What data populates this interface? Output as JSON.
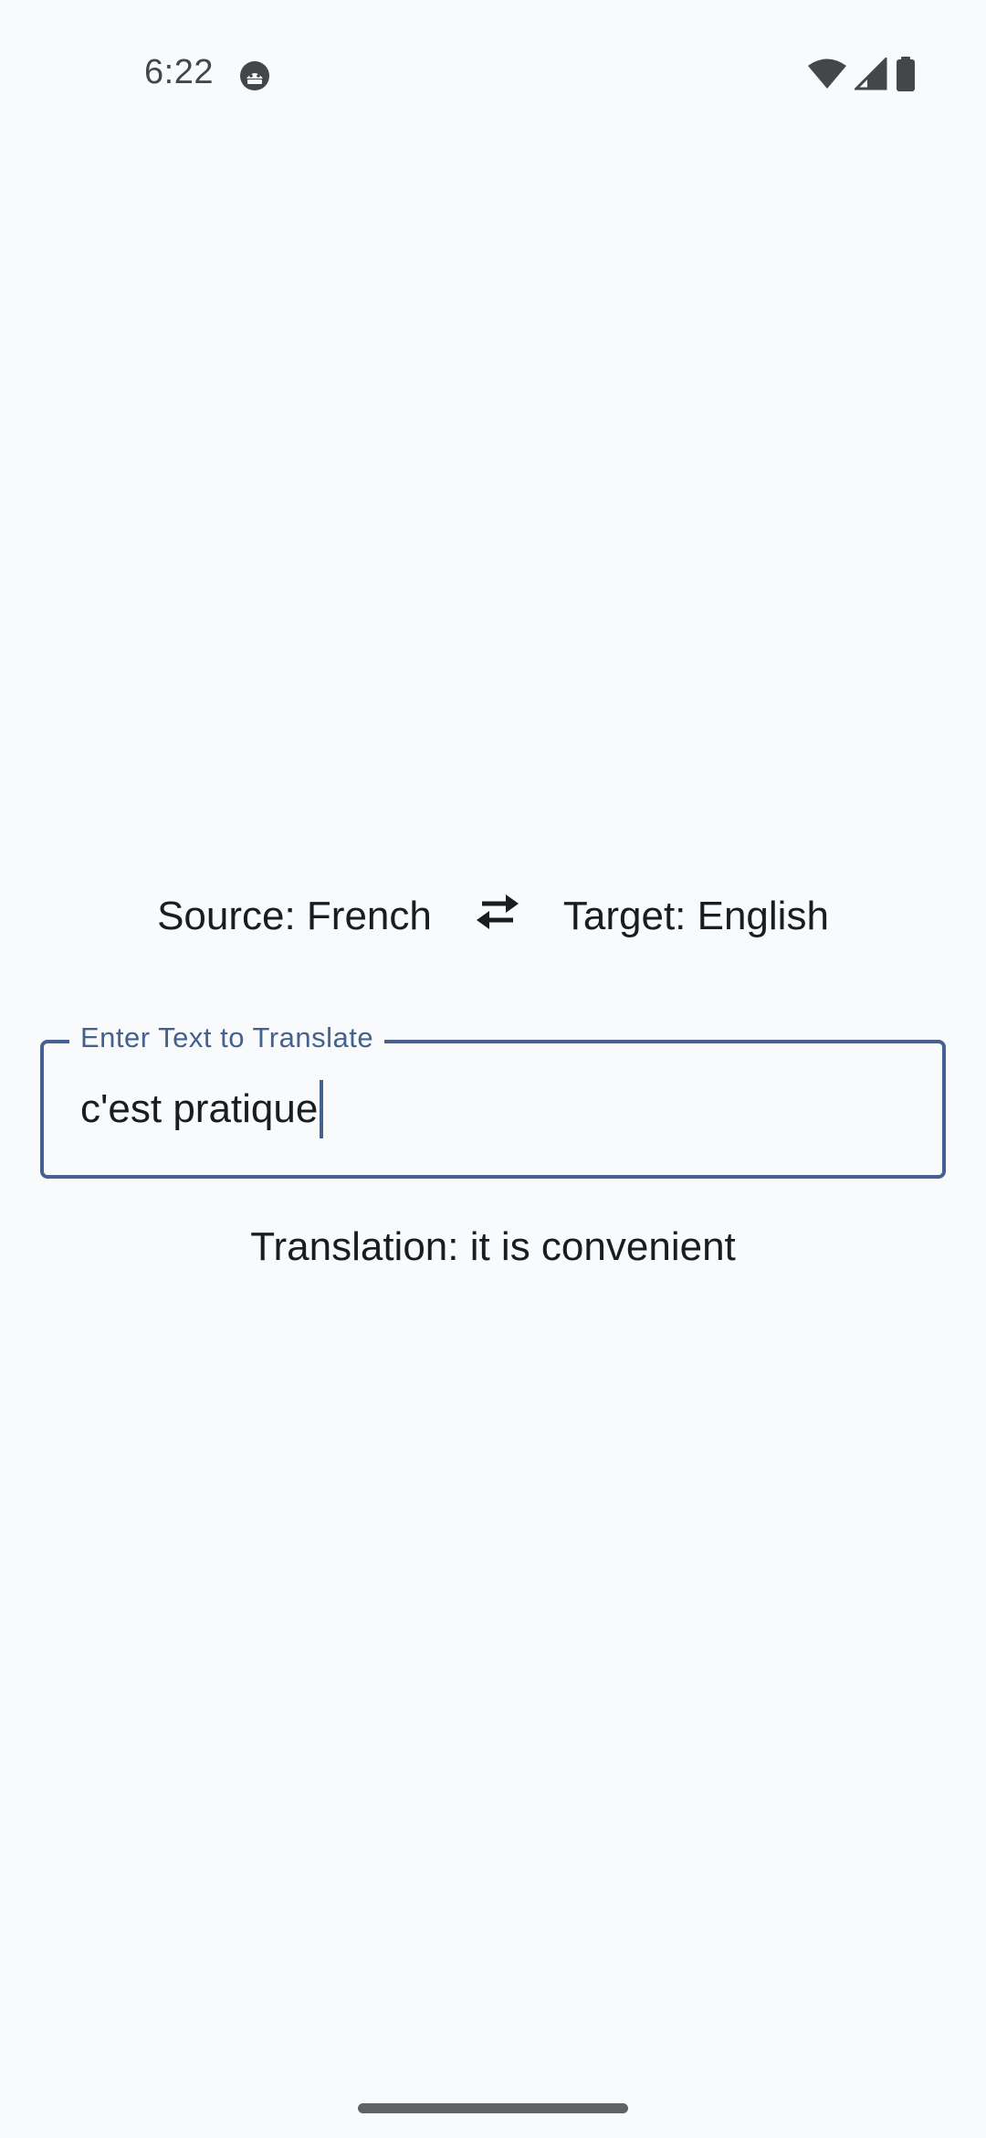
{
  "status_bar": {
    "time": "6:22",
    "app_icon": "android-face-icon",
    "icons": [
      "wifi-icon",
      "signal-icon",
      "battery-icon"
    ]
  },
  "languages": {
    "source_label": "Source: French",
    "target_label": "Target: English",
    "swap_icon": "swap-arrows-icon"
  },
  "input": {
    "label": "Enter Text to Translate",
    "value": "c'est pratique"
  },
  "translation": {
    "text": "Translation: it is convenient"
  },
  "colors": {
    "accent": "#44618f",
    "background": "#f9fafb",
    "text": "#1a1c1e"
  }
}
